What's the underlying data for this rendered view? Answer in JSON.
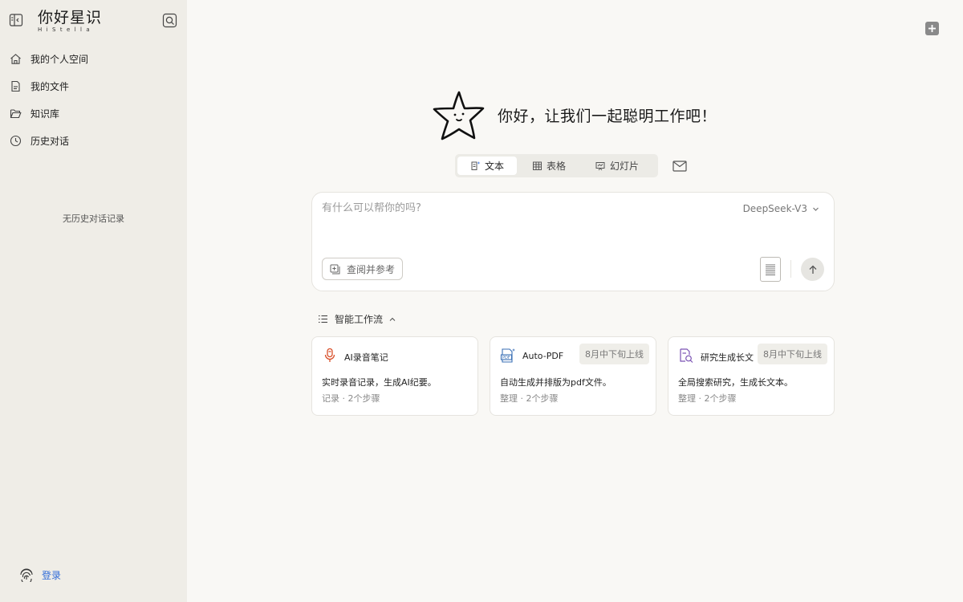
{
  "sidebar": {
    "brand_title": "你好星识",
    "brand_sub": "HiStella",
    "nav": [
      {
        "label": "我的个人空间",
        "icon": "home-icon"
      },
      {
        "label": "我的文件",
        "icon": "file-icon"
      },
      {
        "label": "知识库",
        "icon": "folder-open-icon"
      },
      {
        "label": "历史对话",
        "icon": "clock-icon"
      }
    ],
    "empty_note": "无历史对话记录",
    "login_label": "登录"
  },
  "hero": {
    "greeting": "你好，让我们一起聪明工作吧！"
  },
  "tabs": [
    {
      "label": "文本",
      "icon": "text-doc-icon",
      "active": true
    },
    {
      "label": "表格",
      "icon": "table-icon",
      "active": false
    },
    {
      "label": "幻灯片",
      "icon": "slides-icon",
      "active": false
    }
  ],
  "composer": {
    "placeholder": "有什么可以帮你的吗?",
    "model": "DeepSeek-V3",
    "reference_label": "查阅并参考"
  },
  "workflow": {
    "title": "智能工作流",
    "cards": [
      {
        "title": "AI录音笔记",
        "badge": "",
        "description": "实时录音记录，生成AI纪要。",
        "meta": "记录 · 2个步骤",
        "icon": "microphone-icon"
      },
      {
        "title": "Auto-PDF",
        "badge": "8月中下旬上线",
        "description": "自动生成并排版为pdf文件。",
        "meta": "整理 · 2个步骤",
        "icon": "pdf-icon"
      },
      {
        "title": "研究生成长文",
        "badge": "8月中下旬上线",
        "description": "全局搜索研究，生成长文本。",
        "meta": "整理 · 2个步骤",
        "icon": "doc-search-icon"
      }
    ]
  },
  "colors": {
    "sidebar_bg": "#efede7",
    "main_bg": "#f9f8f5",
    "accent_link": "#2f6bd8"
  }
}
